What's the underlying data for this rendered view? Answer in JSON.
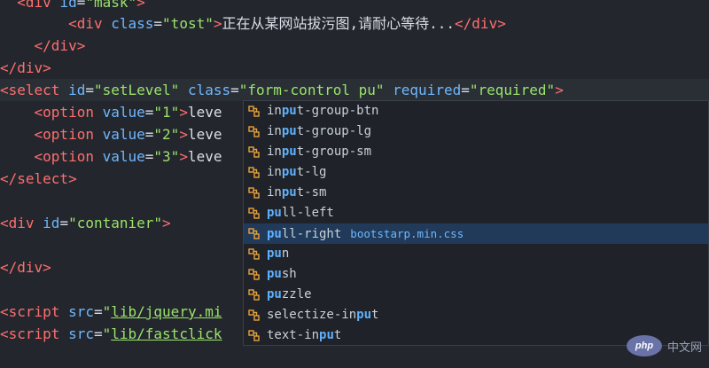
{
  "editor": {
    "lines": [
      {
        "parts": [
          [
            "tag",
            "<div "
          ],
          [
            "attr",
            "id"
          ],
          [
            "txt",
            "="
          ],
          [
            "str",
            "\"mask\""
          ],
          [
            "tag",
            ">"
          ]
        ],
        "indent": "  "
      },
      {
        "parts": [
          [
            "tag",
            "<div "
          ],
          [
            "attr",
            "class"
          ],
          [
            "txt",
            "="
          ],
          [
            "str",
            "\"tost\""
          ],
          [
            "tag",
            ">"
          ],
          [
            "txt",
            "正在从某网站拔污图,请耐心等待..."
          ],
          [
            "tag",
            "</div>"
          ]
        ],
        "indent": "        "
      },
      {
        "parts": [
          [
            "tag",
            "</div>"
          ]
        ],
        "indent": "    "
      },
      {
        "parts": [
          [
            "tag",
            "</div>"
          ]
        ],
        "indent": ""
      },
      {
        "parts": [
          [
            "tag",
            "<select "
          ],
          [
            "attr",
            "id"
          ],
          [
            "txt",
            "="
          ],
          [
            "str",
            "\"setLevel\""
          ],
          [
            "txt",
            " "
          ],
          [
            "attr",
            "class"
          ],
          [
            "txt",
            "="
          ],
          [
            "str",
            "\"form-control pu\""
          ],
          [
            "txt",
            " "
          ],
          [
            "attr",
            "required"
          ],
          [
            "txt",
            "="
          ],
          [
            "str",
            "\"required\""
          ],
          [
            "tag",
            ">"
          ]
        ],
        "indent": "",
        "active": true
      },
      {
        "parts": [
          [
            "tag",
            "<option "
          ],
          [
            "attr",
            "value"
          ],
          [
            "txt",
            "="
          ],
          [
            "str",
            "\"1\""
          ],
          [
            "tag",
            ">"
          ],
          [
            "txt",
            "leve"
          ]
        ],
        "indent": "    "
      },
      {
        "parts": [
          [
            "tag",
            "<option "
          ],
          [
            "attr",
            "value"
          ],
          [
            "txt",
            "="
          ],
          [
            "str",
            "\"2\""
          ],
          [
            "tag",
            ">"
          ],
          [
            "txt",
            "leve"
          ]
        ],
        "indent": "    "
      },
      {
        "parts": [
          [
            "tag",
            "<option "
          ],
          [
            "attr",
            "value"
          ],
          [
            "txt",
            "="
          ],
          [
            "str",
            "\"3\""
          ],
          [
            "tag",
            ">"
          ],
          [
            "txt",
            "leve"
          ]
        ],
        "indent": "    "
      },
      {
        "parts": [
          [
            "tag",
            "</select>"
          ]
        ],
        "indent": ""
      },
      {
        "parts": [],
        "indent": ""
      },
      {
        "parts": [
          [
            "tag",
            "<div "
          ],
          [
            "attr",
            "id"
          ],
          [
            "txt",
            "="
          ],
          [
            "str",
            "\"contanier\""
          ],
          [
            "tag",
            ">"
          ]
        ],
        "indent": ""
      },
      {
        "parts": [],
        "indent": ""
      },
      {
        "parts": [
          [
            "tag",
            "</div>"
          ]
        ],
        "indent": ""
      },
      {
        "parts": [],
        "indent": ""
      },
      {
        "parts": [
          [
            "tag",
            "<script "
          ],
          [
            "attr",
            "src"
          ],
          [
            "txt",
            "="
          ],
          [
            "str",
            "\""
          ],
          [
            "link",
            "lib/jquery.mi"
          ]
        ],
        "indent": ""
      },
      {
        "parts": [
          [
            "tag",
            "<script "
          ],
          [
            "attr",
            "src"
          ],
          [
            "txt",
            "="
          ],
          [
            "str",
            "\""
          ],
          [
            "link",
            "lib/fastclick"
          ]
        ],
        "indent": ""
      }
    ]
  },
  "suggestions": {
    "items": [
      {
        "pre": "in",
        "match": "pu",
        "post": "t-group-btn",
        "detail": ""
      },
      {
        "pre": "in",
        "match": "pu",
        "post": "t-group-lg",
        "detail": ""
      },
      {
        "pre": "in",
        "match": "pu",
        "post": "t-group-sm",
        "detail": ""
      },
      {
        "pre": "in",
        "match": "pu",
        "post": "t-lg",
        "detail": ""
      },
      {
        "pre": "in",
        "match": "pu",
        "post": "t-sm",
        "detail": ""
      },
      {
        "pre": "",
        "match": "pu",
        "post": "ll-left",
        "detail": ""
      },
      {
        "pre": "",
        "match": "pu",
        "post": "ll-right",
        "detail": "bootstarp.min.css",
        "selected": true
      },
      {
        "pre": "",
        "match": "pu",
        "post": "n",
        "detail": ""
      },
      {
        "pre": "",
        "match": "pu",
        "post": "sh",
        "detail": ""
      },
      {
        "pre": "",
        "match": "pu",
        "post": "zzle",
        "detail": ""
      },
      {
        "pre": "selectize-in",
        "match": "pu",
        "post": "t",
        "detail": ""
      },
      {
        "pre": "text-in",
        "match": "pu",
        "post": "t",
        "detail": ""
      }
    ],
    "icon": "class-symbol-icon",
    "icon_color": "#e8a33c"
  },
  "watermark": {
    "badge": "php",
    "text": "中文网"
  }
}
